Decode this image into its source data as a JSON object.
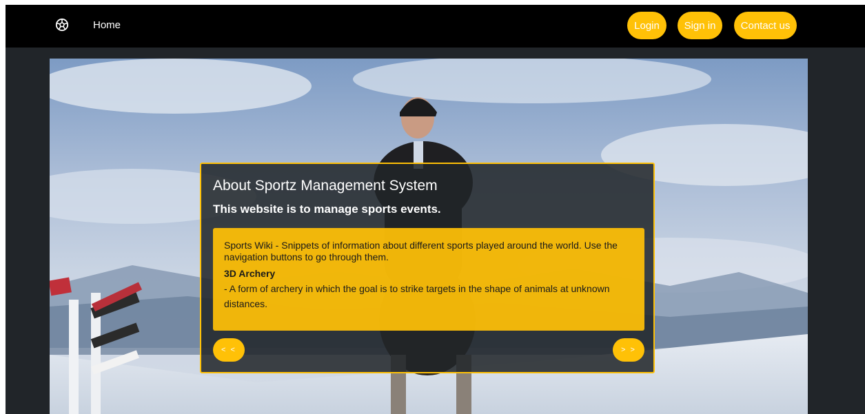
{
  "nav": {
    "brand_icon": "soccer-ball-icon",
    "home_label": "Home",
    "login_label": "Login",
    "signin_label": "Sign in",
    "contact_label": "Contact us"
  },
  "card": {
    "title": "About Sportz Management System",
    "subtitle": "This website is to manage sports events.",
    "wiki_intro": "Sports Wiki - Snippets of information about different sports played around the world. Use the navigation buttons to go through them.",
    "sport_name": "3D Archery",
    "sport_description": "- A form of archery in which the goal is to strike targets in the shape of animals at unknown distances.",
    "prev_label": "< <",
    "next_label": "> >"
  },
  "colors": {
    "accent": "#ffc107",
    "navbar": "#000000",
    "page_background": "#212529",
    "card_background": "#212529"
  }
}
